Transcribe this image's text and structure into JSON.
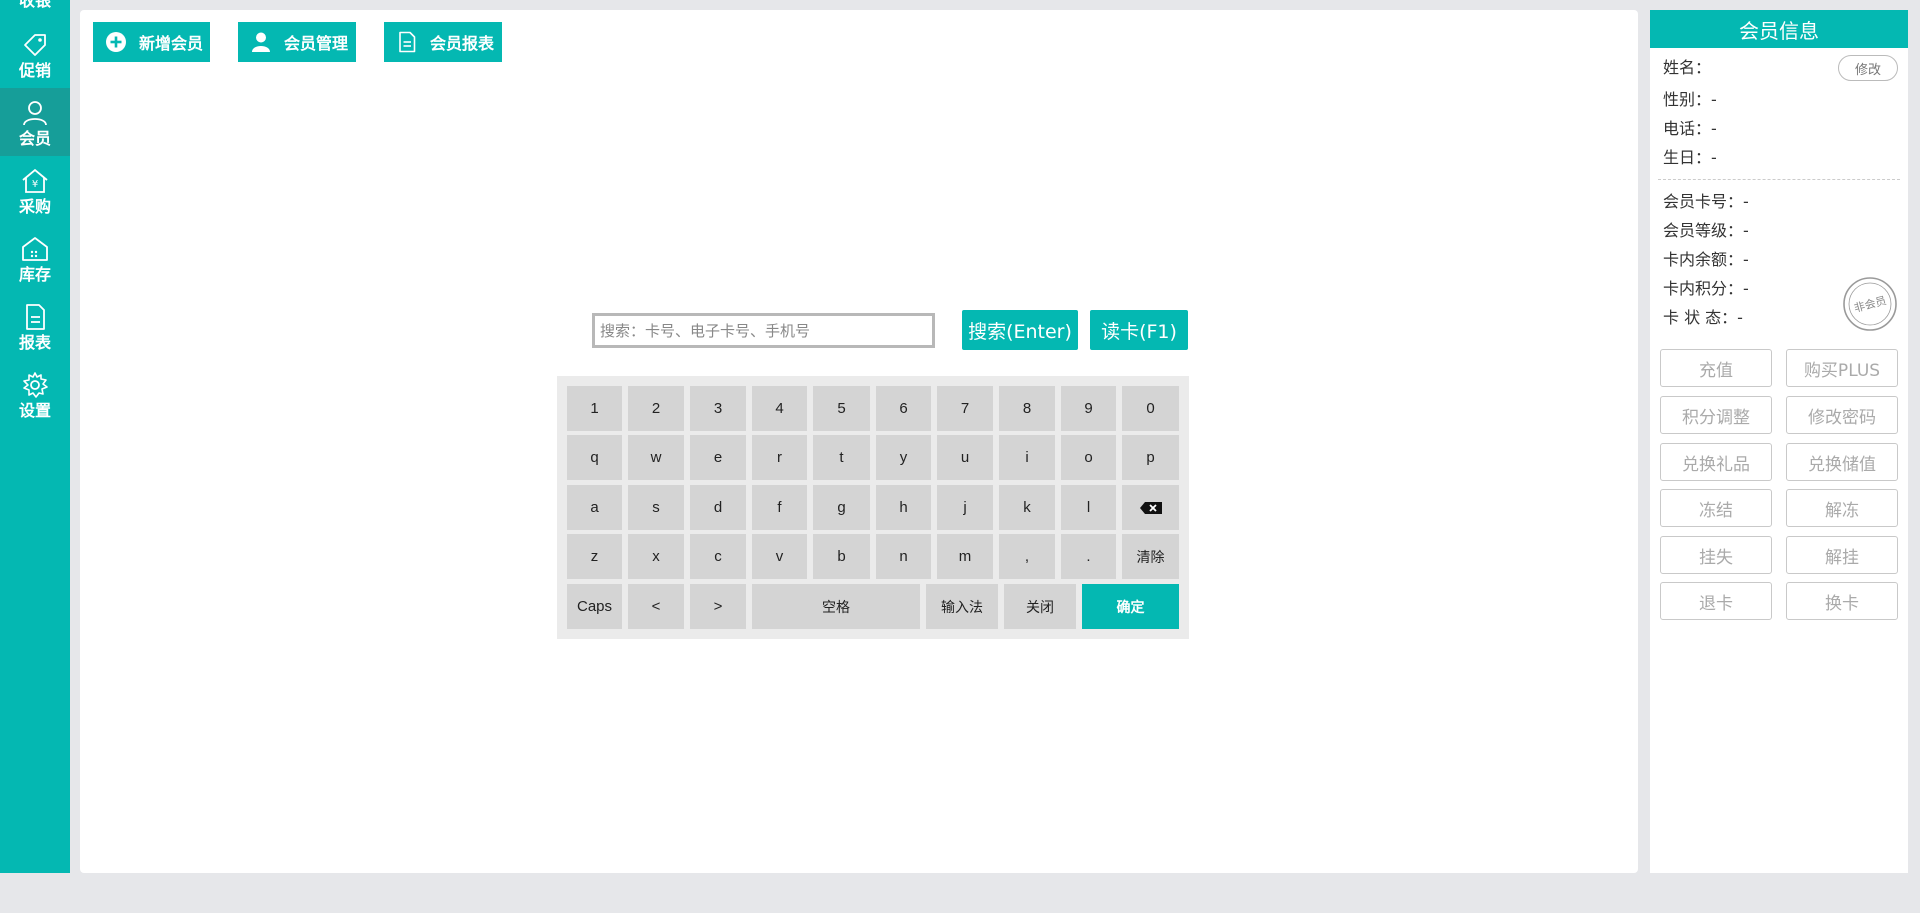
{
  "sidebar": {
    "items": [
      {
        "label": "收银",
        "icon": "cash-register-icon"
      },
      {
        "label": "促销",
        "icon": "tag-icon"
      },
      {
        "label": "会员",
        "icon": "person-icon"
      },
      {
        "label": "采购",
        "icon": "house-yen-icon"
      },
      {
        "label": "库存",
        "icon": "warehouse-icon"
      },
      {
        "label": "报表",
        "icon": "document-icon"
      },
      {
        "label": "设置",
        "icon": "gear-icon"
      }
    ],
    "active": "会员"
  },
  "toolbar": {
    "add_member": "新增会员",
    "member_manage": "会员管理",
    "member_report": "会员报表"
  },
  "search": {
    "placeholder": "搜索：卡号、电子卡号、手机号",
    "value": "",
    "search_button": "搜索(Enter)",
    "read_card_button": "读卡(F1)"
  },
  "keyboard": {
    "row1": [
      "1",
      "2",
      "3",
      "4",
      "5",
      "6",
      "7",
      "8",
      "9",
      "0"
    ],
    "row2": [
      "q",
      "w",
      "e",
      "r",
      "t",
      "y",
      "u",
      "i",
      "o",
      "p"
    ],
    "row3": [
      "a",
      "s",
      "d",
      "f",
      "g",
      "h",
      "j",
      "k",
      "l"
    ],
    "row4": [
      "z",
      "x",
      "c",
      "v",
      "b",
      "n",
      "m",
      ",",
      "."
    ],
    "clear": "清除",
    "caps": "Caps",
    "left": "<",
    "right": ">",
    "space": "空格",
    "ime": "输入法",
    "close": "关闭",
    "confirm": "确定"
  },
  "member_info": {
    "title": "会员信息",
    "edit": "修改",
    "name": "姓名：",
    "gender": "性别：-",
    "phone": "电话：-",
    "birthday": "生日：-",
    "card_no": "会员卡号：-",
    "level": "会员等级：-",
    "balance": "卡内余额：-",
    "points": "卡内积分：-",
    "status": "卡 状 态：-",
    "stamp_text": "非会员"
  },
  "actions": [
    [
      "充值",
      "购买PLUS"
    ],
    [
      "积分调整",
      "修改密码"
    ],
    [
      "兑换礼品",
      "兑换储值"
    ],
    [
      "冻结",
      "解冻"
    ],
    [
      "挂失",
      "解挂"
    ],
    [
      "退卡",
      "换卡"
    ]
  ],
  "colors": {
    "accent": "#04b8b2",
    "active_nav": "#169e99",
    "key": "#d4d4d4",
    "keyboard_bg": "#ebebeb"
  }
}
